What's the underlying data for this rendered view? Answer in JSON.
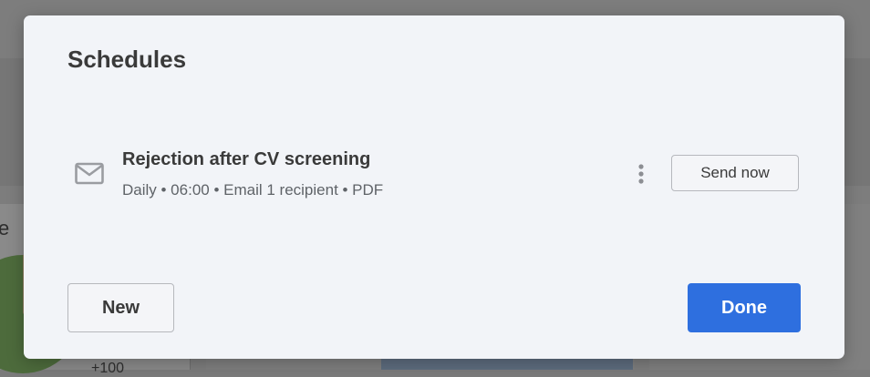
{
  "background": {
    "fragment_left_text": "e",
    "fragment_bottom_text": "+100"
  },
  "modal": {
    "title": "Schedules",
    "schedules": [
      {
        "icon": "mail-icon",
        "name": "Rejection after CV screening",
        "meta": "Daily • 06:00 • Email 1 recipient • PDF",
        "more_icon": "more-vertical-icon",
        "send_now_label": "Send now"
      }
    ],
    "new_label": "New",
    "done_label": "Done"
  },
  "colors": {
    "modal_background": "#f2f4f8",
    "primary": "#2e6fdf",
    "text": "#3a3a3a",
    "muted_text": "#5f6368",
    "overlay": "#7d7d7d"
  }
}
